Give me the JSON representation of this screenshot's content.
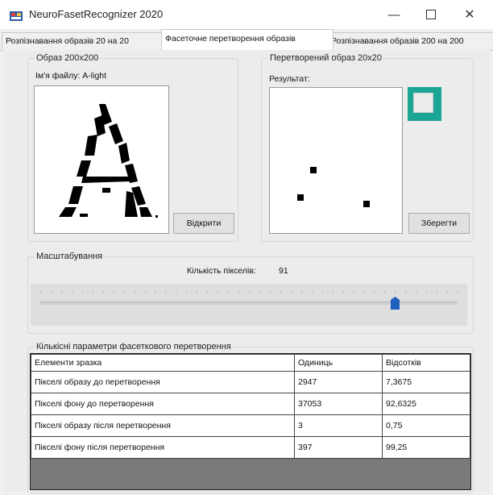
{
  "window": {
    "title": "NeuroFasetRecognizer 2020"
  },
  "tabs": [
    {
      "label": "Розпізнавання образів 20 на 20"
    },
    {
      "label": "Фасеточне перетворення образів"
    },
    {
      "label": "Розпізнавання образів 200 на 200"
    }
  ],
  "source_group": {
    "legend": "Образ 200x200",
    "file_label": "Ім'я файлу: A-light",
    "open_button": "Відкрити"
  },
  "result_group": {
    "legend": "Перетворений образ 20x20",
    "result_label": "Результат:",
    "save_button": "Зберегти"
  },
  "scale_group": {
    "legend": "Масштабування",
    "pixel_count_label": "Кількість пікселів:",
    "pixel_count_value": "91",
    "slider_fraction": 0.85
  },
  "stats_group": {
    "legend": "Кількісні параметри фасеткового перетворення",
    "columns": [
      "Елементи зразка",
      "Одиниць",
      "Відсотків"
    ],
    "rows": [
      [
        "Пікселі образу до перетворення",
        "2947",
        "7,3675"
      ],
      [
        "Пікселі фону до перетворення",
        "37053",
        "92,6325"
      ],
      [
        "Пікселі образу після перетворення",
        "3",
        "0,75"
      ],
      [
        "Пікселі фону після перетворення",
        "397",
        "99,25"
      ]
    ]
  },
  "colors": {
    "accent": "#1aa595",
    "slider_thumb": "#1f5fbf"
  }
}
